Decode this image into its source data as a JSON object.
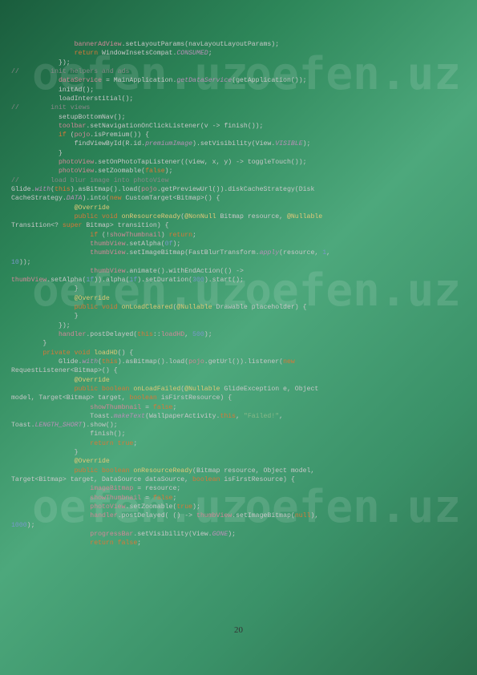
{
  "watermark": "oefen.uz",
  "page_number": "20",
  "code_lines": [
    {
      "indent": 16,
      "tokens": [
        {
          "t": "bannerAdView",
          "c": "pink"
        },
        {
          "t": ".setLayoutParams(navLayoutLayoutParams);",
          "c": "white"
        }
      ]
    },
    {
      "indent": 16,
      "tokens": [
        {
          "t": "return ",
          "c": "orange"
        },
        {
          "t": "WindowInsetsCompat.",
          "c": "white"
        },
        {
          "t": "CONSUMED",
          "c": "purple italic"
        },
        {
          "t": ";",
          "c": "white"
        }
      ]
    },
    {
      "indent": 12,
      "tokens": [
        {
          "t": "});",
          "c": "white"
        }
      ]
    },
    {
      "indent": 0,
      "tokens": [
        {
          "t": "",
          "c": "white"
        }
      ]
    },
    {
      "indent": 0,
      "tokens": [
        {
          "t": "//        init helpers and ads",
          "c": "gray"
        }
      ]
    },
    {
      "indent": 12,
      "tokens": [
        {
          "t": "dataService ",
          "c": "pink"
        },
        {
          "t": "= MainApplication.",
          "c": "white"
        },
        {
          "t": "getDataService",
          "c": "purple italic"
        },
        {
          "t": "(getApplication());",
          "c": "white"
        }
      ]
    },
    {
      "indent": 12,
      "tokens": [
        {
          "t": "initAd();",
          "c": "white"
        }
      ]
    },
    {
      "indent": 12,
      "tokens": [
        {
          "t": "loadInterstitial();",
          "c": "white"
        }
      ]
    },
    {
      "indent": 0,
      "tokens": [
        {
          "t": "",
          "c": "white"
        }
      ]
    },
    {
      "indent": 0,
      "tokens": [
        {
          "t": "//        init views",
          "c": "gray"
        }
      ]
    },
    {
      "indent": 12,
      "tokens": [
        {
          "t": "setupBottomNav();",
          "c": "white"
        }
      ]
    },
    {
      "indent": 12,
      "tokens": [
        {
          "t": "toolbar",
          "c": "pink"
        },
        {
          "t": ".setNavigationOnClickListener(v -> finish());",
          "c": "white"
        }
      ]
    },
    {
      "indent": 12,
      "tokens": [
        {
          "t": "if ",
          "c": "orange"
        },
        {
          "t": "(",
          "c": "white"
        },
        {
          "t": "pojo",
          "c": "pink"
        },
        {
          "t": ".isPremium()) {",
          "c": "white"
        }
      ]
    },
    {
      "indent": 16,
      "tokens": [
        {
          "t": "findViewById(R.id.",
          "c": "white"
        },
        {
          "t": "premiumImage",
          "c": "purple italic"
        },
        {
          "t": ").setVisibility(View.",
          "c": "white"
        },
        {
          "t": "VISIBLE",
          "c": "purple italic"
        },
        {
          "t": ");",
          "c": "white"
        }
      ]
    },
    {
      "indent": 12,
      "tokens": [
        {
          "t": "}",
          "c": "white"
        }
      ]
    },
    {
      "indent": 12,
      "tokens": [
        {
          "t": "photoView",
          "c": "pink"
        },
        {
          "t": ".setOnPhotoTapListener((view, x, y) -> toggleTouch());",
          "c": "white"
        }
      ]
    },
    {
      "indent": 12,
      "tokens": [
        {
          "t": "photoView",
          "c": "pink"
        },
        {
          "t": ".setZoomable(",
          "c": "white"
        },
        {
          "t": "false",
          "c": "orange"
        },
        {
          "t": ");",
          "c": "white"
        }
      ]
    },
    {
      "indent": 0,
      "tokens": [
        {
          "t": "",
          "c": "white"
        }
      ]
    },
    {
      "indent": 0,
      "tokens": [
        {
          "t": "//        load blur image into photoView",
          "c": "gray"
        }
      ]
    },
    {
      "indent": 0,
      "tokens": [
        {
          "t": "",
          "c": "white"
        }
      ]
    },
    {
      "indent": 0,
      "tokens": [
        {
          "t": "Glide.",
          "c": "white"
        },
        {
          "t": "with",
          "c": "purple italic"
        },
        {
          "t": "(",
          "c": "white"
        },
        {
          "t": "this",
          "c": "orange"
        },
        {
          "t": ").asBitmap().load(",
          "c": "white"
        },
        {
          "t": "pojo",
          "c": "pink"
        },
        {
          "t": ".getPreviewUrl()).diskCacheStrategy(Disk",
          "c": "white"
        }
      ]
    },
    {
      "indent": 0,
      "tokens": [
        {
          "t": "CacheStrategy.",
          "c": "white"
        },
        {
          "t": "DATA",
          "c": "purple italic"
        },
        {
          "t": ").into(",
          "c": "white"
        },
        {
          "t": "new ",
          "c": "orange"
        },
        {
          "t": "CustomTarget<Bitmap>() {",
          "c": "white"
        }
      ]
    },
    {
      "indent": 16,
      "tokens": [
        {
          "t": "@Override",
          "c": "yellow"
        }
      ]
    },
    {
      "indent": 16,
      "tokens": [
        {
          "t": "public void ",
          "c": "orange"
        },
        {
          "t": "onResourceReady",
          "c": "yellow"
        },
        {
          "t": "(",
          "c": "white"
        },
        {
          "t": "@NonNull ",
          "c": "yellow"
        },
        {
          "t": "Bitmap resource, ",
          "c": "white"
        },
        {
          "t": "@Nullable ",
          "c": "yellow"
        }
      ]
    },
    {
      "indent": 0,
      "tokens": [
        {
          "t": "Transition<? ",
          "c": "white"
        },
        {
          "t": "super ",
          "c": "orange"
        },
        {
          "t": "Bitmap> transition) {",
          "c": "white"
        }
      ]
    },
    {
      "indent": 20,
      "tokens": [
        {
          "t": "if ",
          "c": "orange"
        },
        {
          "t": "(!",
          "c": "white"
        },
        {
          "t": "showThumbnail",
          "c": "pink"
        },
        {
          "t": ") ",
          "c": "white"
        },
        {
          "t": "return",
          "c": "orange"
        },
        {
          "t": ";",
          "c": "white"
        }
      ]
    },
    {
      "indent": 20,
      "tokens": [
        {
          "t": "thumbView",
          "c": "pink"
        },
        {
          "t": ".setAlpha(",
          "c": "white"
        },
        {
          "t": "0f",
          "c": "blue"
        },
        {
          "t": ");",
          "c": "white"
        }
      ]
    },
    {
      "indent": 20,
      "tokens": [
        {
          "t": "thumbView",
          "c": "pink"
        },
        {
          "t": ".setImageBitmap(FastBlurTransform.",
          "c": "white"
        },
        {
          "t": "apply",
          "c": "purple italic"
        },
        {
          "t": "(resource, ",
          "c": "white"
        },
        {
          "t": "1",
          "c": "blue"
        },
        {
          "t": ", ",
          "c": "white"
        }
      ]
    },
    {
      "indent": 0,
      "tokens": [
        {
          "t": "10",
          "c": "blue"
        },
        {
          "t": "));",
          "c": "white"
        }
      ]
    },
    {
      "indent": 20,
      "tokens": [
        {
          "t": "thumbView",
          "c": "pink"
        },
        {
          "t": ".animate().withEndAction(() -> ",
          "c": "white"
        }
      ]
    },
    {
      "indent": 0,
      "tokens": [
        {
          "t": "thumbView",
          "c": "pink"
        },
        {
          "t": ".setAlpha(",
          "c": "white"
        },
        {
          "t": "1f",
          "c": "blue"
        },
        {
          "t": ")).alpha(",
          "c": "white"
        },
        {
          "t": "1f",
          "c": "blue"
        },
        {
          "t": ").setDuration(",
          "c": "white"
        },
        {
          "t": "300",
          "c": "blue"
        },
        {
          "t": ").start();",
          "c": "white"
        }
      ]
    },
    {
      "indent": 16,
      "tokens": [
        {
          "t": "}",
          "c": "white"
        }
      ]
    },
    {
      "indent": 0,
      "tokens": [
        {
          "t": "",
          "c": "white"
        }
      ]
    },
    {
      "indent": 16,
      "tokens": [
        {
          "t": "@Override",
          "c": "yellow"
        }
      ]
    },
    {
      "indent": 16,
      "tokens": [
        {
          "t": "public void ",
          "c": "orange"
        },
        {
          "t": "onLoadCleared",
          "c": "yellow"
        },
        {
          "t": "(",
          "c": "white"
        },
        {
          "t": "@Nullable ",
          "c": "yellow"
        },
        {
          "t": "Drawable placeholder) {",
          "c": "white"
        }
      ]
    },
    {
      "indent": 16,
      "tokens": [
        {
          "t": "}",
          "c": "white"
        }
      ]
    },
    {
      "indent": 12,
      "tokens": [
        {
          "t": "});",
          "c": "white"
        }
      ]
    },
    {
      "indent": 12,
      "tokens": [
        {
          "t": "handler",
          "c": "pink"
        },
        {
          "t": ".postDelayed(",
          "c": "white"
        },
        {
          "t": "this",
          "c": "orange"
        },
        {
          "t": "::",
          "c": "white"
        },
        {
          "t": "loadHD",
          "c": "pink"
        },
        {
          "t": ", ",
          "c": "white"
        },
        {
          "t": "500",
          "c": "blue"
        },
        {
          "t": ");",
          "c": "white"
        }
      ]
    },
    {
      "indent": 8,
      "tokens": [
        {
          "t": "}",
          "c": "white"
        }
      ]
    },
    {
      "indent": 0,
      "tokens": [
        {
          "t": "",
          "c": "white"
        }
      ]
    },
    {
      "indent": 8,
      "tokens": [
        {
          "t": "private void ",
          "c": "orange"
        },
        {
          "t": "loadHD",
          "c": "yellow"
        },
        {
          "t": "() {",
          "c": "white"
        }
      ]
    },
    {
      "indent": 12,
      "tokens": [
        {
          "t": "Glide.",
          "c": "white"
        },
        {
          "t": "with",
          "c": "purple italic"
        },
        {
          "t": "(",
          "c": "white"
        },
        {
          "t": "this",
          "c": "orange"
        },
        {
          "t": ").asBitmap().load(",
          "c": "white"
        },
        {
          "t": "pojo",
          "c": "pink"
        },
        {
          "t": ".getUrl()).listener(",
          "c": "white"
        },
        {
          "t": "new ",
          "c": "orange"
        }
      ]
    },
    {
      "indent": 0,
      "tokens": [
        {
          "t": "RequestListener<Bitmap>() {",
          "c": "white"
        }
      ]
    },
    {
      "indent": 16,
      "tokens": [
        {
          "t": "@Override",
          "c": "yellow"
        }
      ]
    },
    {
      "indent": 16,
      "tokens": [
        {
          "t": "public boolean ",
          "c": "orange"
        },
        {
          "t": "onLoadFailed",
          "c": "yellow"
        },
        {
          "t": "(",
          "c": "white"
        },
        {
          "t": "@Nullable ",
          "c": "yellow"
        },
        {
          "t": "GlideException e, Object ",
          "c": "white"
        }
      ]
    },
    {
      "indent": 0,
      "tokens": [
        {
          "t": "model, Target<Bitmap> target, ",
          "c": "white"
        },
        {
          "t": "boolean ",
          "c": "orange"
        },
        {
          "t": "isFirstResource) {",
          "c": "white"
        }
      ]
    },
    {
      "indent": 20,
      "tokens": [
        {
          "t": "showThumbnail ",
          "c": "pink"
        },
        {
          "t": "= ",
          "c": "white"
        },
        {
          "t": "false",
          "c": "orange"
        },
        {
          "t": ";",
          "c": "white"
        }
      ]
    },
    {
      "indent": 20,
      "tokens": [
        {
          "t": "Toast.",
          "c": "white"
        },
        {
          "t": "makeText",
          "c": "purple italic"
        },
        {
          "t": "(WallpaperActivity.",
          "c": "white"
        },
        {
          "t": "this",
          "c": "orange"
        },
        {
          "t": ", ",
          "c": "white"
        },
        {
          "t": "\"Failed!\"",
          "c": "green"
        },
        {
          "t": ", ",
          "c": "white"
        }
      ]
    },
    {
      "indent": 0,
      "tokens": [
        {
          "t": "Toast.",
          "c": "white"
        },
        {
          "t": "LENGTH_SHORT",
          "c": "purple italic"
        },
        {
          "t": ").show();",
          "c": "white"
        }
      ]
    },
    {
      "indent": 20,
      "tokens": [
        {
          "t": "finish();",
          "c": "white"
        }
      ]
    },
    {
      "indent": 20,
      "tokens": [
        {
          "t": "return true",
          "c": "orange"
        },
        {
          "t": ";",
          "c": "white"
        }
      ]
    },
    {
      "indent": 16,
      "tokens": [
        {
          "t": "}",
          "c": "white"
        }
      ]
    },
    {
      "indent": 0,
      "tokens": [
        {
          "t": "",
          "c": "white"
        }
      ]
    },
    {
      "indent": 16,
      "tokens": [
        {
          "t": "@Override",
          "c": "yellow"
        }
      ]
    },
    {
      "indent": 16,
      "tokens": [
        {
          "t": "public boolean ",
          "c": "orange"
        },
        {
          "t": "onResourceReady",
          "c": "yellow"
        },
        {
          "t": "(Bitmap resource, Object model, ",
          "c": "white"
        }
      ]
    },
    {
      "indent": 0,
      "tokens": [
        {
          "t": "Target<Bitmap> target, DataSource dataSource, ",
          "c": "white"
        },
        {
          "t": "boolean ",
          "c": "orange"
        },
        {
          "t": "isFirstResource) {",
          "c": "white"
        }
      ]
    },
    {
      "indent": 20,
      "tokens": [
        {
          "t": "imageBitmap ",
          "c": "pink"
        },
        {
          "t": "= resource;",
          "c": "white"
        }
      ]
    },
    {
      "indent": 20,
      "tokens": [
        {
          "t": "showThumbnail ",
          "c": "pink"
        },
        {
          "t": "= ",
          "c": "white"
        },
        {
          "t": "false",
          "c": "orange"
        },
        {
          "t": ";",
          "c": "white"
        }
      ]
    },
    {
      "indent": 20,
      "tokens": [
        {
          "t": "photoView",
          "c": "pink"
        },
        {
          "t": ".setZoomable(",
          "c": "white"
        },
        {
          "t": "true",
          "c": "orange"
        },
        {
          "t": ");",
          "c": "white"
        }
      ]
    },
    {
      "indent": 20,
      "tokens": [
        {
          "t": "handler",
          "c": "pink"
        },
        {
          "t": ".postDelayed( () -> ",
          "c": "white"
        },
        {
          "t": "thumbView",
          "c": "pink"
        },
        {
          "t": ".setImageBitmap(",
          "c": "white"
        },
        {
          "t": "null",
          "c": "orange"
        },
        {
          "t": "), ",
          "c": "white"
        }
      ]
    },
    {
      "indent": 0,
      "tokens": [
        {
          "t": "1000",
          "c": "blue"
        },
        {
          "t": ");",
          "c": "white"
        }
      ]
    },
    {
      "indent": 0,
      "tokens": [
        {
          "t": "",
          "c": "white"
        }
      ]
    },
    {
      "indent": 20,
      "tokens": [
        {
          "t": "progressBar",
          "c": "pink"
        },
        {
          "t": ".setVisibility(View.",
          "c": "white"
        },
        {
          "t": "GONE",
          "c": "purple italic"
        },
        {
          "t": ");",
          "c": "white"
        }
      ]
    },
    {
      "indent": 20,
      "tokens": [
        {
          "t": "return false",
          "c": "orange"
        },
        {
          "t": ";",
          "c": "white"
        }
      ]
    }
  ]
}
